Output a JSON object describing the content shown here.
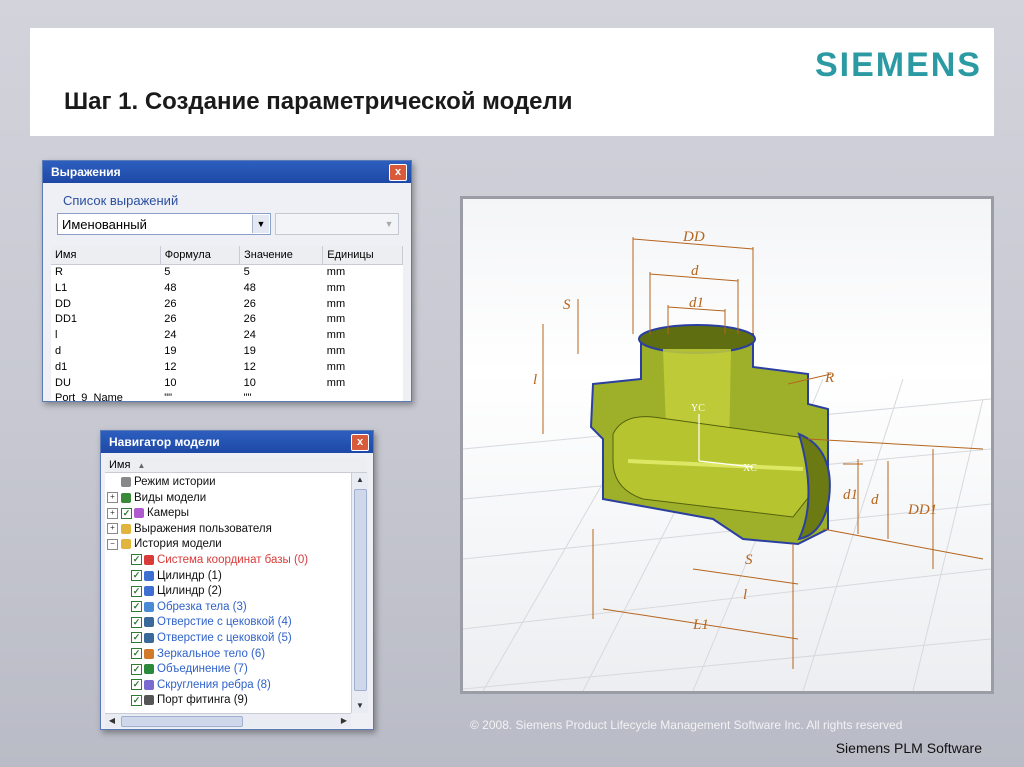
{
  "header": {
    "title": "Шаг 1. Создание параметрической модели",
    "logo": "SIEMENS"
  },
  "expressions_window": {
    "title": "Выражения",
    "close": "x",
    "section_label": "Список выражений",
    "filter_value": "Именованный",
    "columns": [
      "Имя",
      "Формула",
      "Значение",
      "Единицы"
    ],
    "rows": [
      [
        "R",
        "5",
        "5",
        "mm"
      ],
      [
        "L1",
        "48",
        "48",
        "mm"
      ],
      [
        "DD",
        "26",
        "26",
        "mm"
      ],
      [
        "DD1",
        "26",
        "26",
        "mm"
      ],
      [
        "l",
        "24",
        "24",
        "mm"
      ],
      [
        "d",
        "19",
        "19",
        "mm"
      ],
      [
        "d1",
        "12",
        "12",
        "mm"
      ],
      [
        "DU",
        "10",
        "10",
        "mm"
      ],
      [
        "Port_9_Name",
        "\"\"",
        "\"\"",
        ""
      ]
    ]
  },
  "navigator": {
    "title": "Навигатор модели",
    "close": "x",
    "column": "Имя",
    "nodes": [
      {
        "label": "Режим истории",
        "expander": "",
        "checked": false,
        "icon": "clock-icon",
        "color": "#111111"
      },
      {
        "label": "Виды модели",
        "expander": "+",
        "checked": false,
        "icon": "views-icon",
        "color": "#111111"
      },
      {
        "label": "Камеры",
        "expander": "+",
        "checked": true,
        "icon": "camera-icon",
        "color": "#111111"
      },
      {
        "label": "Выражения пользователя",
        "expander": "+",
        "checked": false,
        "icon": "folder-icon",
        "color": "#111111"
      },
      {
        "label": "История модели",
        "expander": "−",
        "checked": false,
        "icon": "folder-open-icon",
        "color": "#111111"
      },
      {
        "label": "Система координат базы (0)",
        "expander": "",
        "checked": true,
        "icon": "csys-icon",
        "color": "#d93a3a"
      },
      {
        "label": "Цилиндр (1)",
        "expander": "",
        "checked": true,
        "icon": "cylinder-icon",
        "color": "#111111"
      },
      {
        "label": "Цилиндр (2)",
        "expander": "",
        "checked": true,
        "icon": "cylinder-icon",
        "color": "#111111"
      },
      {
        "label": "Обрезка тела (3)",
        "expander": "",
        "checked": true,
        "icon": "trim-body-icon",
        "color": "#2f62c9"
      },
      {
        "label": "Отверстие с цековкой (4)",
        "expander": "",
        "checked": true,
        "icon": "hole-icon",
        "color": "#2f62c9"
      },
      {
        "label": "Отверстие с цековкой (5)",
        "expander": "",
        "checked": true,
        "icon": "hole-icon",
        "color": "#2f62c9"
      },
      {
        "label": "Зеркальное тело (6)",
        "expander": "",
        "checked": true,
        "icon": "mirror-icon",
        "color": "#2f62c9"
      },
      {
        "label": "Объединение (7)",
        "expander": "",
        "checked": true,
        "icon": "unite-icon",
        "color": "#2f62c9"
      },
      {
        "label": "Скругления ребра (8)",
        "expander": "",
        "checked": true,
        "icon": "blend-icon",
        "color": "#2f62c9"
      },
      {
        "label": "Порт фитинга (9)",
        "expander": "",
        "checked": true,
        "icon": "port-icon",
        "color": "#111111"
      }
    ]
  },
  "model_labels": [
    "DD",
    "d",
    "d1",
    "S",
    "l",
    "R",
    "YC",
    "XC",
    "d1",
    "d",
    "DD1",
    "S",
    "l",
    "L1"
  ],
  "footer": {
    "copyright": "© 2008. Siemens Product Lifecycle Management Software Inc. All rights reserved",
    "brand": "Siemens PLM Software"
  },
  "colors": {
    "accent": "#2b9aa3",
    "titlebar": "#1e48a6",
    "model_green": "#8fa31a",
    "dimension": "#b5651d"
  }
}
